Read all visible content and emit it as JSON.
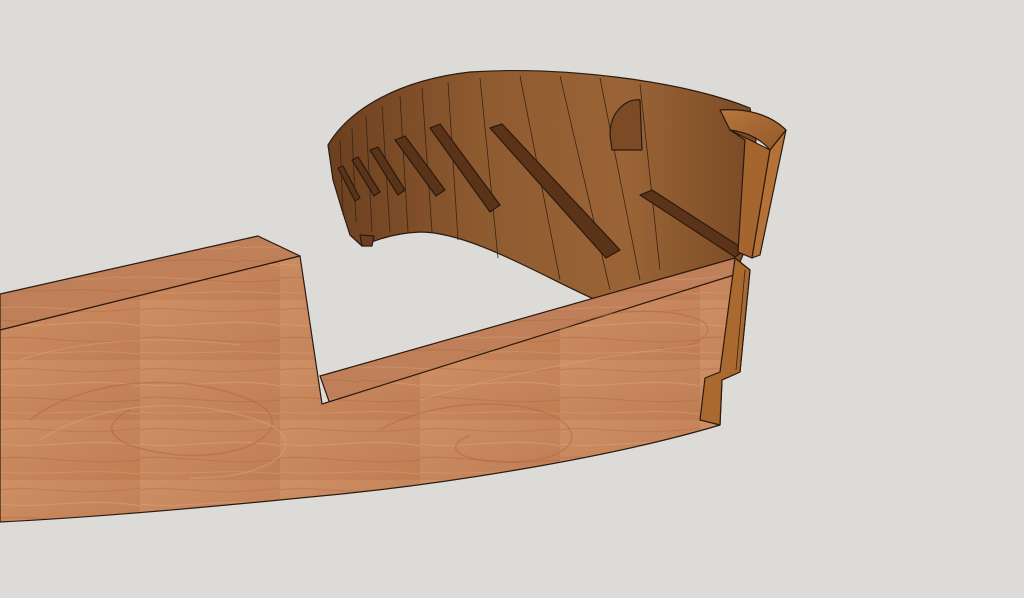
{
  "viewport": {
    "background_color": "#dcdbd8"
  },
  "model": {
    "material": "wood",
    "colors": {
      "front_face": "#c98a60",
      "front_face_grain": "#b26f48",
      "top_face": "#b87752",
      "inner_shell": "#8e5a30",
      "inner_shell_dark": "#6b3f1f",
      "rim_face": "#a96a36",
      "rim_side": "#8f5526",
      "edge_line": "#2a1a10"
    }
  }
}
